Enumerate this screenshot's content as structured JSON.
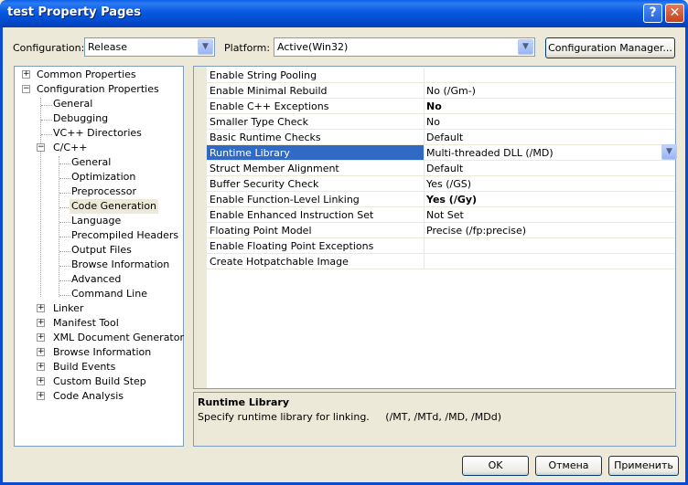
{
  "window": {
    "title": "test Property Pages"
  },
  "toolbar": {
    "configuration_label": "Configuration:",
    "configuration_value": "Release",
    "platform_label": "Platform:",
    "platform_value": "Active(Win32)",
    "config_manager_label": "Configuration Manager..."
  },
  "tree": [
    {
      "label": "Common Properties",
      "expander": "+"
    },
    {
      "label": "Configuration Properties",
      "expander": "−"
    },
    {
      "label": "General"
    },
    {
      "label": "Debugging"
    },
    {
      "label": "VC++ Directories"
    },
    {
      "label": "C/C++",
      "expander": "−"
    },
    {
      "label": "General"
    },
    {
      "label": "Optimization"
    },
    {
      "label": "Preprocessor"
    },
    {
      "label": "Code Generation",
      "selected": true
    },
    {
      "label": "Language"
    },
    {
      "label": "Precompiled Headers"
    },
    {
      "label": "Output Files"
    },
    {
      "label": "Browse Information"
    },
    {
      "label": "Advanced"
    },
    {
      "label": "Command Line"
    },
    {
      "label": "Linker",
      "expander": "+"
    },
    {
      "label": "Manifest Tool",
      "expander": "+"
    },
    {
      "label": "XML Document Generator",
      "expander": "+"
    },
    {
      "label": "Browse Information",
      "expander": "+"
    },
    {
      "label": "Build Events",
      "expander": "+"
    },
    {
      "label": "Custom Build Step",
      "expander": "+"
    },
    {
      "label": "Code Analysis",
      "expander": "+"
    }
  ],
  "properties": [
    {
      "name": "Enable String Pooling",
      "value": ""
    },
    {
      "name": "Enable Minimal Rebuild",
      "value": "No (/Gm-)"
    },
    {
      "name": "Enable C++ Exceptions",
      "value": "No",
      "bold": true
    },
    {
      "name": "Smaller Type Check",
      "value": "No"
    },
    {
      "name": "Basic Runtime Checks",
      "value": "Default"
    },
    {
      "name": "Runtime Library",
      "value": "Multi-threaded DLL (/MD)",
      "selected": true
    },
    {
      "name": "Struct Member Alignment",
      "value": "Default"
    },
    {
      "name": "Buffer Security Check",
      "value": "Yes (/GS)"
    },
    {
      "name": "Enable Function-Level Linking",
      "value": "Yes (/Gy)",
      "bold": true
    },
    {
      "name": "Enable Enhanced Instruction Set",
      "value": "Not Set"
    },
    {
      "name": "Floating Point Model",
      "value": "Precise (/fp:precise)"
    },
    {
      "name": "Enable Floating Point Exceptions",
      "value": ""
    },
    {
      "name": "Create Hotpatchable Image",
      "value": ""
    }
  ],
  "description": {
    "title": "Runtime Library",
    "text": "Specify runtime library for linking.     (/MT, /MTd, /MD, /MDd)"
  },
  "buttons": {
    "ok": "OK",
    "cancel": "Отмена",
    "apply": "Применить"
  },
  "colors": {
    "selection": "#316AC5",
    "titlebar": "#0758E0",
    "face": "#ECE9D8"
  }
}
